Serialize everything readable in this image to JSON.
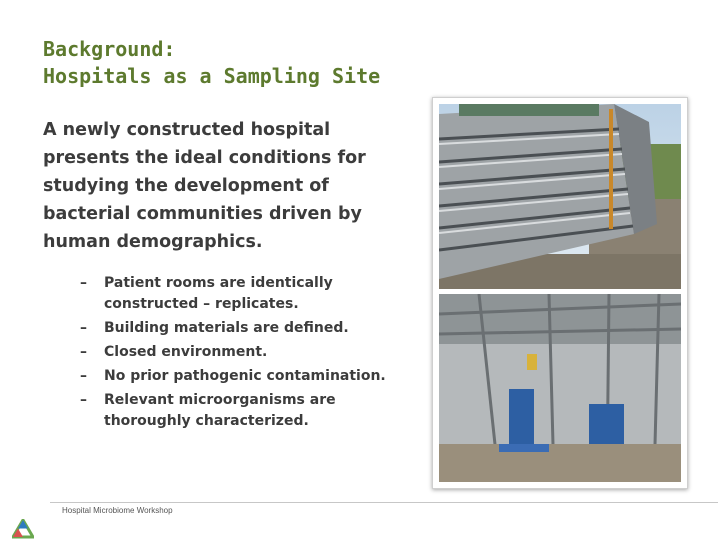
{
  "slide": {
    "title_line1": "Background:",
    "title_line2": "Hospitals as a Sampling Site",
    "lead": "A newly constructed hospital presents the ideal conditions for studying the development of bacterial communities driven by human demographics.",
    "bullets": [
      "Patient rooms are identically constructed – replicates.",
      "Building materials are defined.",
      "Closed environment.",
      "No prior pathogenic contamination.",
      "Relevant microorganisms are thoroughly characterized."
    ],
    "bullet_marker": "–"
  },
  "footer": {
    "text": "Hospital Microbiome Workshop"
  },
  "colors": {
    "title": "#5d7a2e",
    "body": "#3c3c3c",
    "logo_green": "#6aa84f",
    "logo_blue": "#2f7bbf",
    "logo_red": "#d9534f"
  },
  "images": {
    "top": "hospital-construction-exterior-photo",
    "bottom": "hospital-construction-interior-photo"
  }
}
